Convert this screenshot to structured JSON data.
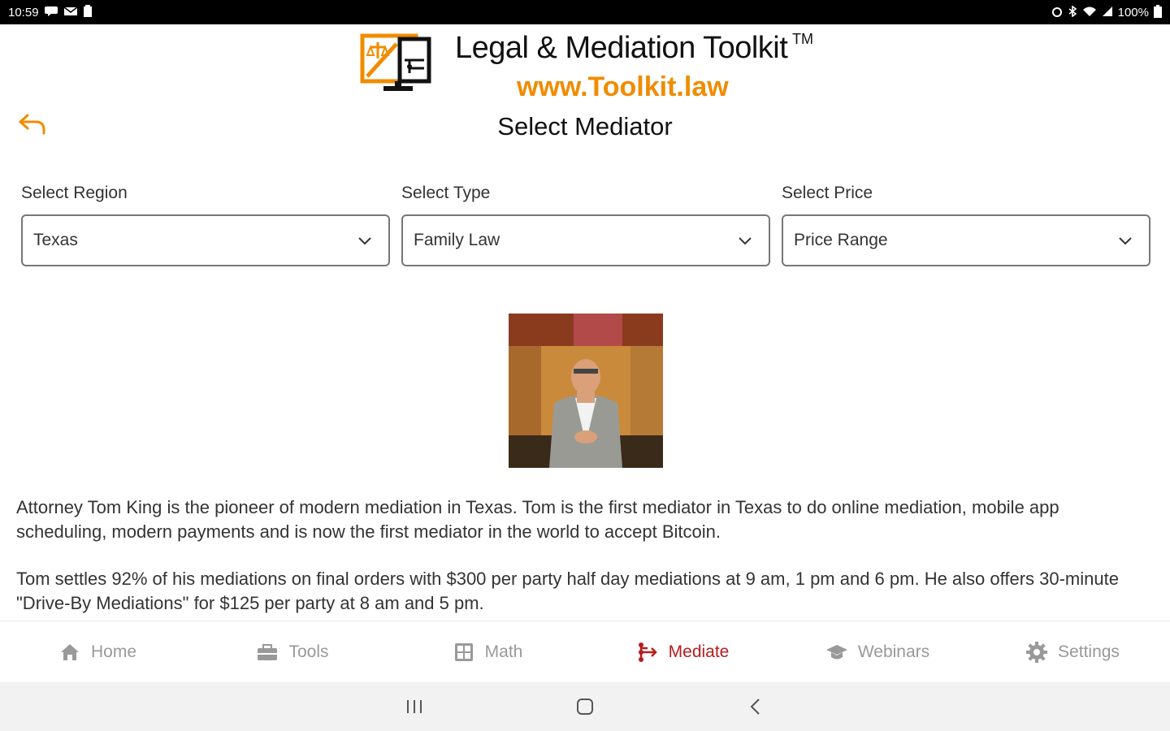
{
  "status_bar": {
    "time": "10:59",
    "battery": "100%",
    "left_icons": [
      "message-icon",
      "mail-icon",
      "clipboard-icon"
    ],
    "right_icons": [
      "alarm-icon",
      "bluetooth-icon",
      "wifi-icon",
      "signal-icon",
      "battery-icon"
    ]
  },
  "header": {
    "title": "Legal & Mediation Toolkit",
    "trademark": "TM",
    "url": "www.Toolkit.law",
    "url_color": "#f08c00"
  },
  "page": {
    "title": "Select Mediator",
    "back_icon": "undo-arrow-icon"
  },
  "filters": [
    {
      "label": "Select Region",
      "value": "Texas"
    },
    {
      "label": "Select Type",
      "value": "Family Law"
    },
    {
      "label": "Select Price",
      "value": "Price Range"
    }
  ],
  "bio": {
    "paragraph1": "Attorney Tom King is the pioneer of modern mediation in Texas. Tom is the first mediator in Texas to do online mediation, mobile app scheduling, modern payments and is now the first mediator in the world to accept Bitcoin.",
    "paragraph2": "Tom settles 92% of his mediations on final orders with $300 per party half day mediations at 9 am, 1 pm and 6 pm. He also offers 30-minute \"Drive-By Mediations\" for $125 per party at 8 am and 5 pm."
  },
  "tabs": [
    {
      "label": "Home",
      "icon": "home-icon",
      "active": false
    },
    {
      "label": "Tools",
      "icon": "toolbox-icon",
      "active": false
    },
    {
      "label": "Math",
      "icon": "calculator-icon",
      "active": false
    },
    {
      "label": "Mediate",
      "icon": "branch-icon",
      "active": true
    },
    {
      "label": "Webinars",
      "icon": "graduation-cap-icon",
      "active": false
    },
    {
      "label": "Settings",
      "icon": "gear-icon",
      "active": false
    }
  ],
  "colors": {
    "accent_orange": "#f08c00",
    "active_tab": "#b71c1c",
    "inactive_tab": "#999999"
  }
}
